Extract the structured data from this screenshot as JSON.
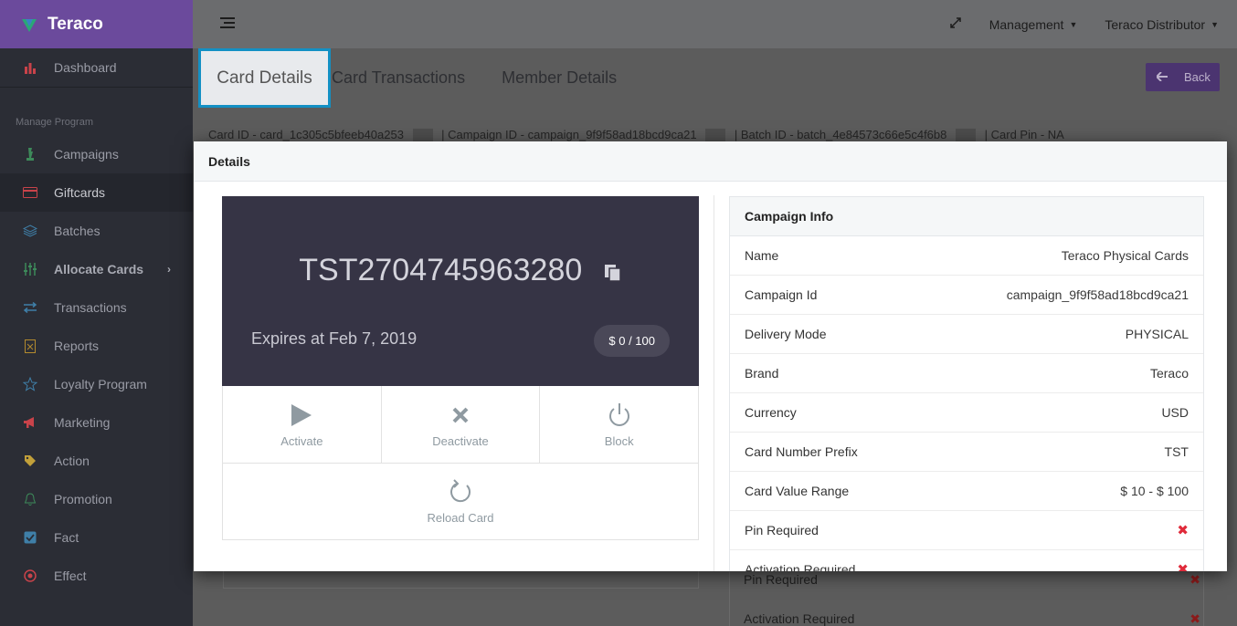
{
  "brand": {
    "name": "Teraco"
  },
  "sidebar": {
    "dashboard": "Dashboard",
    "section_label": "Manage Program",
    "items": [
      {
        "label": "Campaigns"
      },
      {
        "label": "Giftcards"
      },
      {
        "label": "Batches"
      },
      {
        "label": "Allocate Cards"
      },
      {
        "label": "Transactions"
      },
      {
        "label": "Reports"
      },
      {
        "label": "Loyalty Program"
      },
      {
        "label": "Marketing"
      },
      {
        "label": "Action"
      },
      {
        "label": "Promotion"
      },
      {
        "label": "Fact"
      },
      {
        "label": "Effect"
      }
    ]
  },
  "topbar": {
    "management": "Management",
    "distributor": "Teraco Distributor"
  },
  "tabs": {
    "card_details": "Card Details",
    "card_transactions": "Card Transactions",
    "member_details": "Member Details",
    "back": "Back"
  },
  "idbar": {
    "card_id": "Card ID - card_1c305c5bfeeb40a253",
    "campaign_id": "Campaign ID - campaign_9f9f58ad18bcd9ca21",
    "batch_id": "Batch ID - batch_4e84573c66e5c4f6b8",
    "card_pin": "Card Pin - NA"
  },
  "behind": {
    "pin_required": "Pin Required",
    "activation_required": "Activation Required"
  },
  "modal": {
    "title": "Details",
    "card": {
      "number": "TST2704745963280",
      "expires": "Expires at Feb 7, 2019",
      "balance": "$ 0 / 100"
    },
    "actions": {
      "activate": "Activate",
      "deactivate": "Deactivate",
      "block": "Block",
      "reload": "Reload Card"
    },
    "campaign_info": {
      "title": "Campaign Info",
      "rows": [
        {
          "label": "Name",
          "value": "Teraco Physical Cards"
        },
        {
          "label": "Campaign Id",
          "value": "campaign_9f9f58ad18bcd9ca21"
        },
        {
          "label": "Delivery Mode",
          "value": "PHYSICAL"
        },
        {
          "label": "Brand",
          "value": "Teraco"
        },
        {
          "label": "Currency",
          "value": "USD"
        },
        {
          "label": "Card Number Prefix",
          "value": "TST"
        },
        {
          "label": "Card Value Range",
          "value": "$ 10 - $ 100"
        }
      ],
      "pin_required": "Pin Required",
      "activation_required": "Activation Required"
    }
  },
  "colors": {
    "brand": "#6b4a9c",
    "accent": "#1390c4",
    "card_bg": "#363445",
    "danger": "#e02a3a"
  }
}
